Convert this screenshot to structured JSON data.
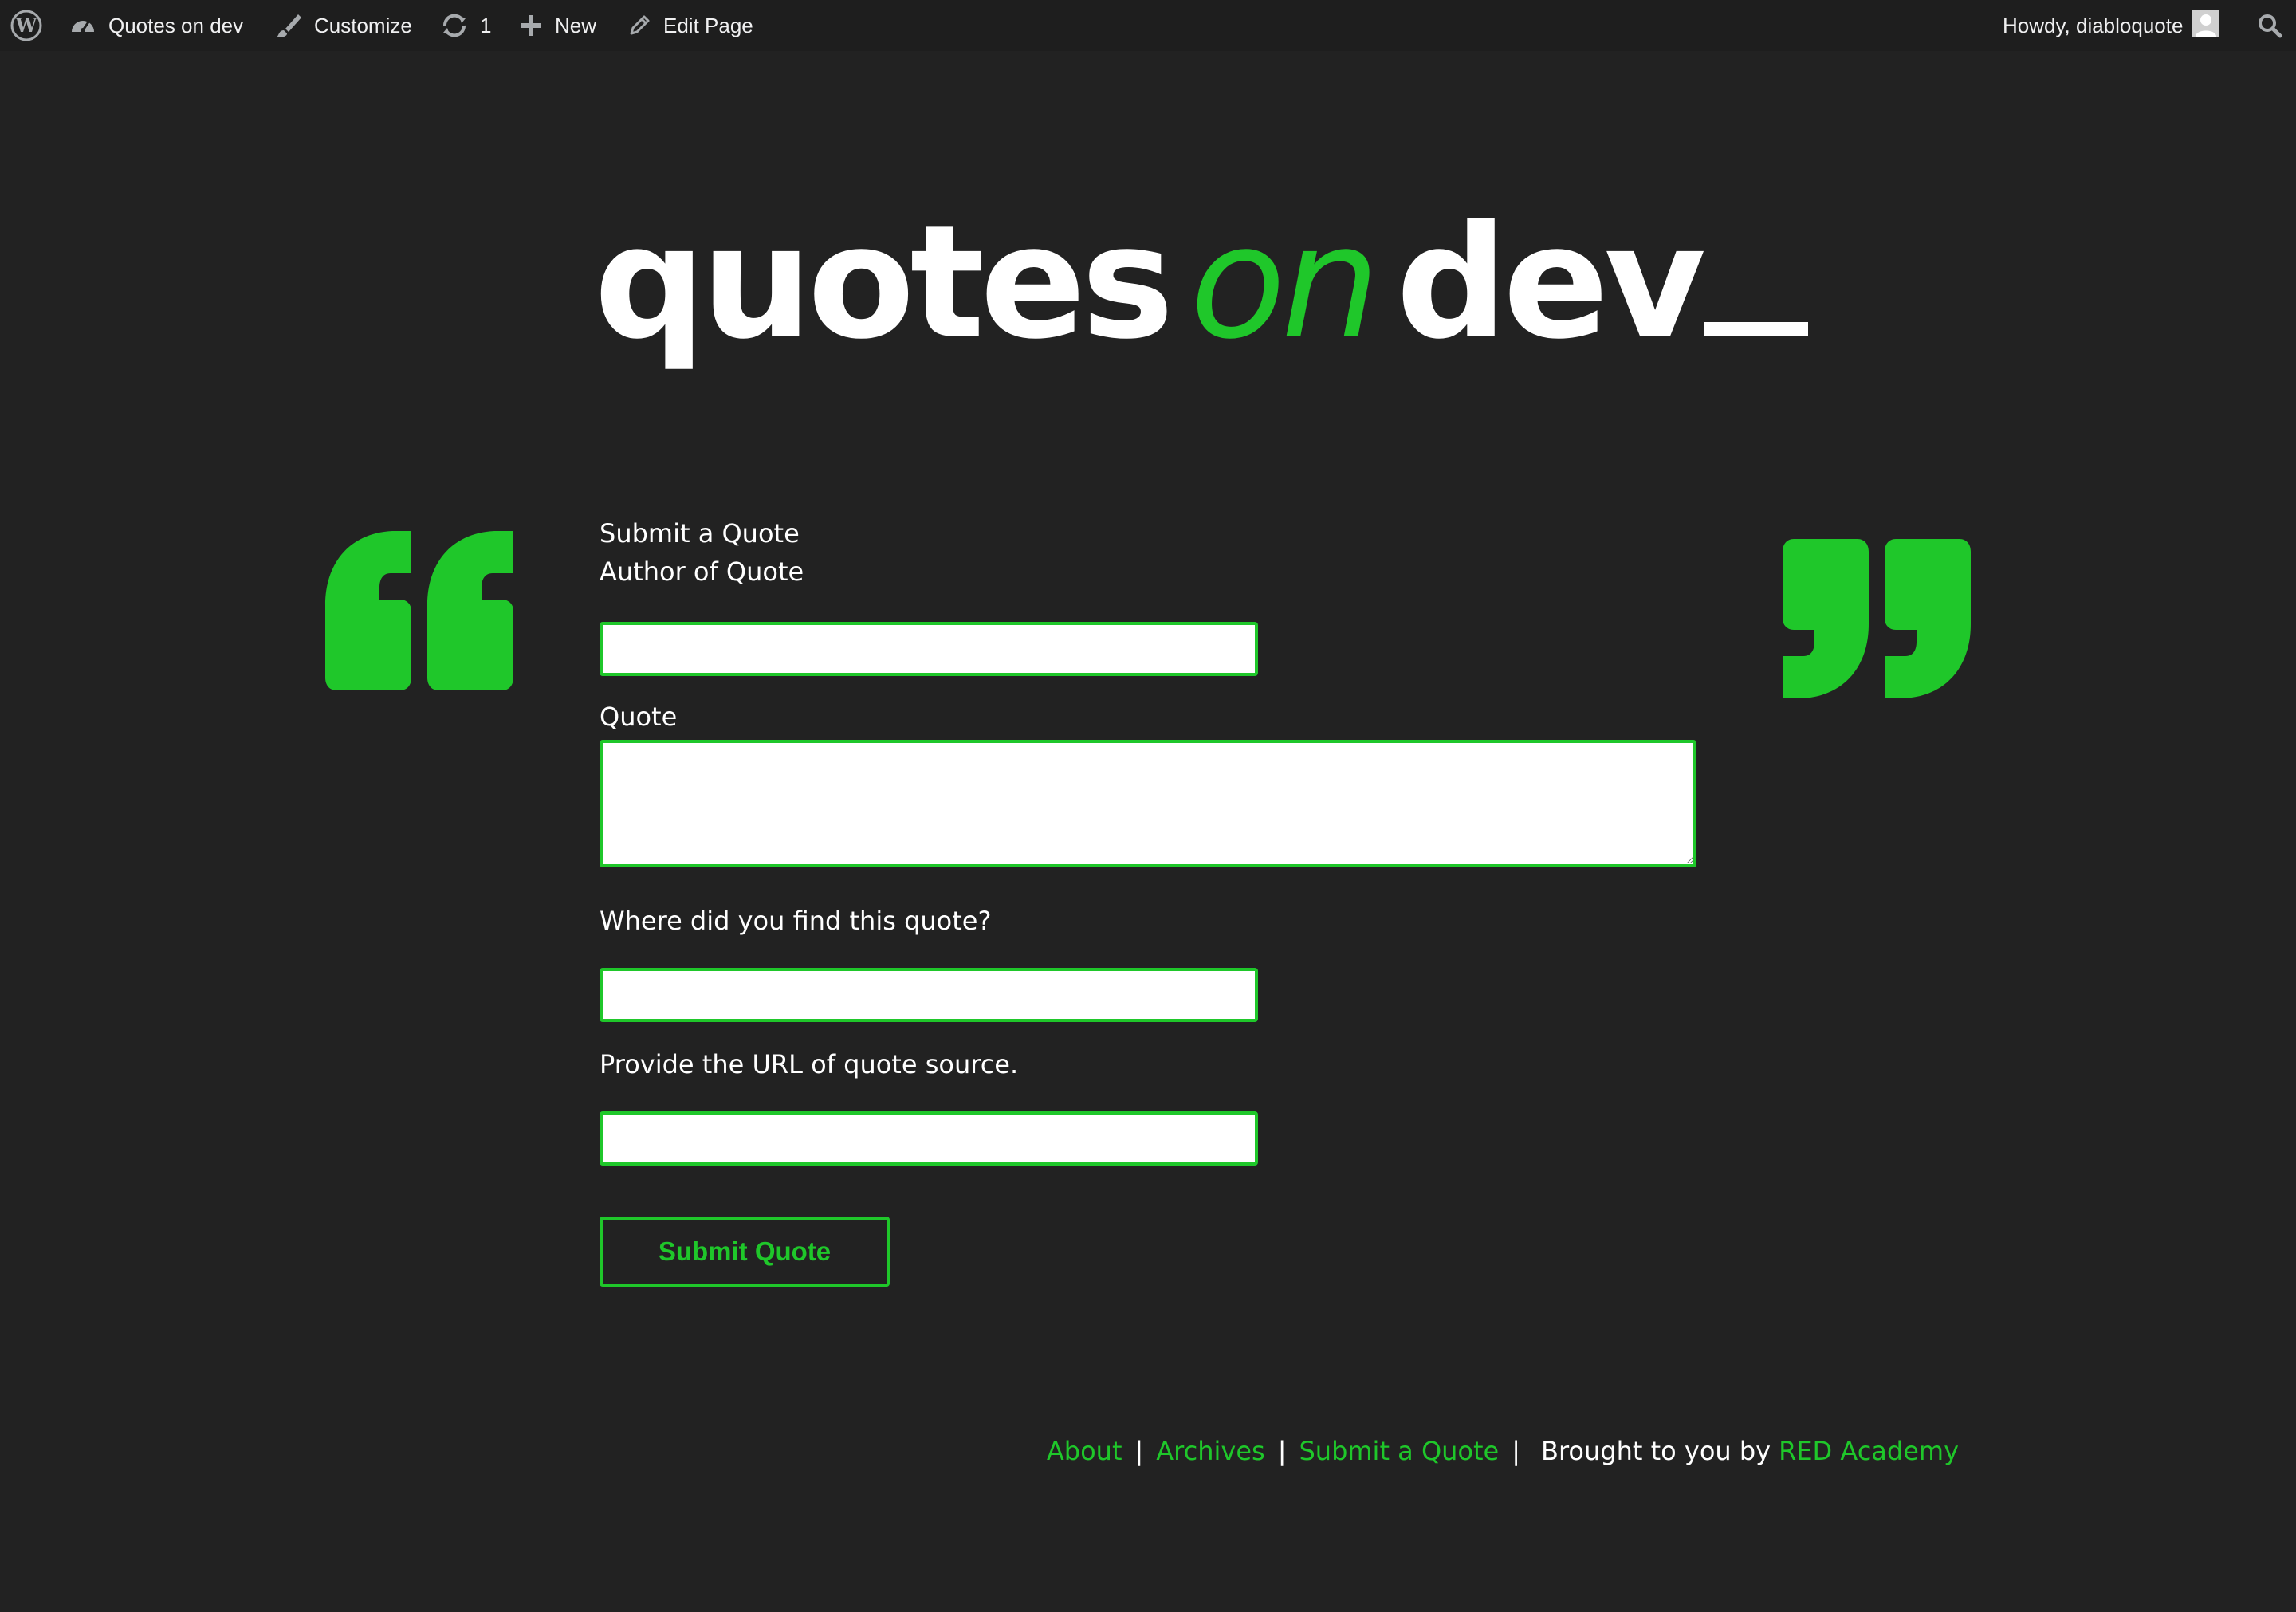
{
  "adminbar": {
    "site_name": "Quotes on dev",
    "customize": "Customize",
    "updates_count": "1",
    "new": "New",
    "edit_page": "Edit Page",
    "howdy": "Howdy, diabloquote"
  },
  "site": {
    "title_part1": "quotes",
    "title_part2": "on",
    "title_part3": "dev"
  },
  "form": {
    "heading": "Submit a Quote",
    "author_label": "Author of Quote",
    "author_value": "",
    "quote_label": "Quote",
    "quote_value": "",
    "source_label": "Where did you find this quote?",
    "source_value": "",
    "url_label": "Provide the URL of quote source.",
    "url_value": "",
    "submit_label": "Submit Quote"
  },
  "footer": {
    "links": [
      "About",
      "Archives",
      "Submit a Quote"
    ],
    "credit_text": "Brought to you by",
    "credit_link": "RED Academy"
  },
  "colors": {
    "background": "#222222",
    "accent": "#1fc72a",
    "adminbar": "#1e1e1e",
    "text": "#ffffff"
  },
  "icons": [
    "wordpress-logo-icon",
    "dashboard-icon",
    "paintbrush-icon",
    "updates-icon",
    "plus-icon",
    "pencil-icon",
    "avatar",
    "search-icon",
    "open-quote-icon",
    "close-quote-icon"
  ]
}
